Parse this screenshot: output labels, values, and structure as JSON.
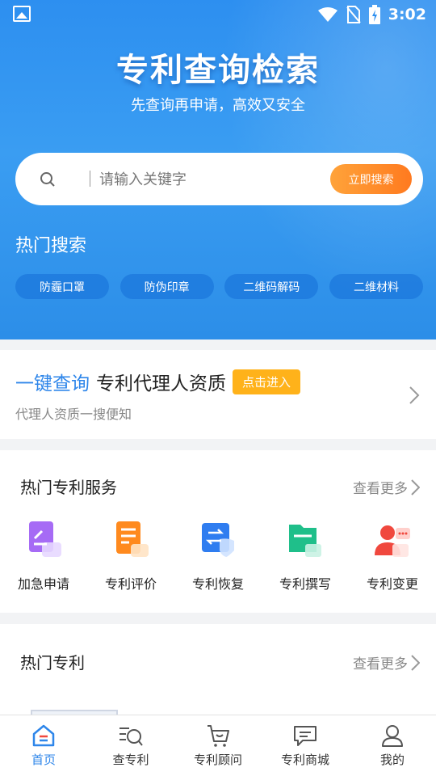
{
  "status": {
    "time": "3:02"
  },
  "hero": {
    "title": "专利查询检索",
    "subtitle": "先查询再申请，高效又安全"
  },
  "search": {
    "placeholder": "请输入关键字",
    "button": "立即搜索"
  },
  "hot": {
    "title": "热门搜索",
    "tags": [
      "防霾口罩",
      "防伪印章",
      "二维码解码",
      "二维材料"
    ]
  },
  "agent": {
    "highlight": "一键查询",
    "title": "专利代理人资质",
    "badge": "点击进入",
    "desc": "代理人资质一搜便知"
  },
  "services": {
    "title": "热门专利服务",
    "more": "查看更多",
    "items": [
      {
        "label": "加急申请",
        "icon": "urgent-apply-icon",
        "color": "#9b5cf0"
      },
      {
        "label": "专利评价",
        "icon": "patent-evaluation-icon",
        "color": "#ff8a1e"
      },
      {
        "label": "专利恢复",
        "icon": "patent-restore-icon",
        "color": "#2f7df0"
      },
      {
        "label": "专利撰写",
        "icon": "patent-writing-icon",
        "color": "#1fbf8a"
      },
      {
        "label": "专利变更",
        "icon": "patent-change-icon",
        "color": "#f0483e"
      }
    ]
  },
  "patents": {
    "title": "热门专利",
    "more": "查看更多"
  },
  "tabs": [
    {
      "label": "首页",
      "icon": "home-icon",
      "active": true
    },
    {
      "label": "查专利",
      "icon": "search-patent-icon",
      "active": false
    },
    {
      "label": "专利顾问",
      "icon": "advisor-icon",
      "active": false
    },
    {
      "label": "专利商城",
      "icon": "mall-icon",
      "active": false
    },
    {
      "label": "我的",
      "icon": "profile-icon",
      "active": false
    }
  ],
  "colors": {
    "primary": "#2e86ea",
    "accent": "#ff8a1e",
    "badge": "#ffb21a"
  }
}
